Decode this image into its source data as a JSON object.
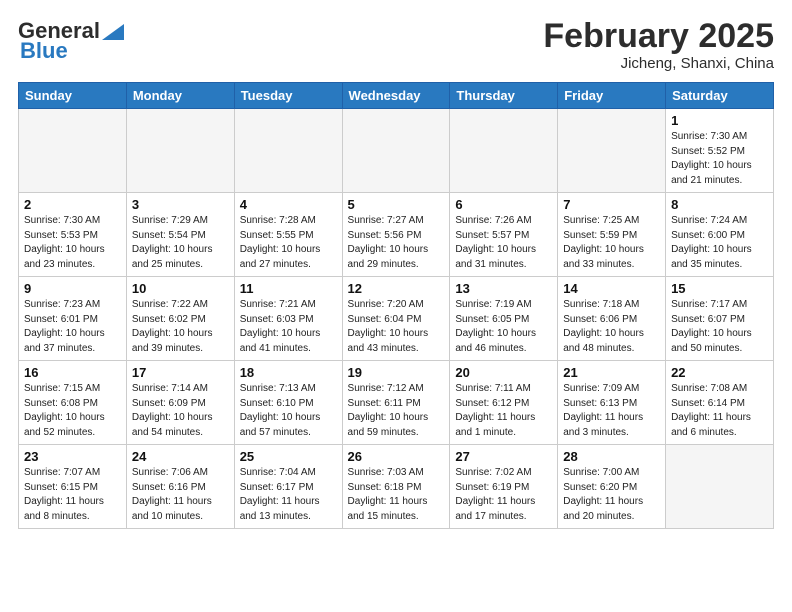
{
  "header": {
    "logo_general": "General",
    "logo_blue": "Blue",
    "month_title": "February 2025",
    "location": "Jicheng, Shanxi, China"
  },
  "weekdays": [
    "Sunday",
    "Monday",
    "Tuesday",
    "Wednesday",
    "Thursday",
    "Friday",
    "Saturday"
  ],
  "weeks": [
    [
      {
        "day": "",
        "info": ""
      },
      {
        "day": "",
        "info": ""
      },
      {
        "day": "",
        "info": ""
      },
      {
        "day": "",
        "info": ""
      },
      {
        "day": "",
        "info": ""
      },
      {
        "day": "",
        "info": ""
      },
      {
        "day": "1",
        "info": "Sunrise: 7:30 AM\nSunset: 5:52 PM\nDaylight: 10 hours and 21 minutes."
      }
    ],
    [
      {
        "day": "2",
        "info": "Sunrise: 7:30 AM\nSunset: 5:53 PM\nDaylight: 10 hours and 23 minutes."
      },
      {
        "day": "3",
        "info": "Sunrise: 7:29 AM\nSunset: 5:54 PM\nDaylight: 10 hours and 25 minutes."
      },
      {
        "day": "4",
        "info": "Sunrise: 7:28 AM\nSunset: 5:55 PM\nDaylight: 10 hours and 27 minutes."
      },
      {
        "day": "5",
        "info": "Sunrise: 7:27 AM\nSunset: 5:56 PM\nDaylight: 10 hours and 29 minutes."
      },
      {
        "day": "6",
        "info": "Sunrise: 7:26 AM\nSunset: 5:57 PM\nDaylight: 10 hours and 31 minutes."
      },
      {
        "day": "7",
        "info": "Sunrise: 7:25 AM\nSunset: 5:59 PM\nDaylight: 10 hours and 33 minutes."
      },
      {
        "day": "8",
        "info": "Sunrise: 7:24 AM\nSunset: 6:00 PM\nDaylight: 10 hours and 35 minutes."
      }
    ],
    [
      {
        "day": "9",
        "info": "Sunrise: 7:23 AM\nSunset: 6:01 PM\nDaylight: 10 hours and 37 minutes."
      },
      {
        "day": "10",
        "info": "Sunrise: 7:22 AM\nSunset: 6:02 PM\nDaylight: 10 hours and 39 minutes."
      },
      {
        "day": "11",
        "info": "Sunrise: 7:21 AM\nSunset: 6:03 PM\nDaylight: 10 hours and 41 minutes."
      },
      {
        "day": "12",
        "info": "Sunrise: 7:20 AM\nSunset: 6:04 PM\nDaylight: 10 hours and 43 minutes."
      },
      {
        "day": "13",
        "info": "Sunrise: 7:19 AM\nSunset: 6:05 PM\nDaylight: 10 hours and 46 minutes."
      },
      {
        "day": "14",
        "info": "Sunrise: 7:18 AM\nSunset: 6:06 PM\nDaylight: 10 hours and 48 minutes."
      },
      {
        "day": "15",
        "info": "Sunrise: 7:17 AM\nSunset: 6:07 PM\nDaylight: 10 hours and 50 minutes."
      }
    ],
    [
      {
        "day": "16",
        "info": "Sunrise: 7:15 AM\nSunset: 6:08 PM\nDaylight: 10 hours and 52 minutes."
      },
      {
        "day": "17",
        "info": "Sunrise: 7:14 AM\nSunset: 6:09 PM\nDaylight: 10 hours and 54 minutes."
      },
      {
        "day": "18",
        "info": "Sunrise: 7:13 AM\nSunset: 6:10 PM\nDaylight: 10 hours and 57 minutes."
      },
      {
        "day": "19",
        "info": "Sunrise: 7:12 AM\nSunset: 6:11 PM\nDaylight: 10 hours and 59 minutes."
      },
      {
        "day": "20",
        "info": "Sunrise: 7:11 AM\nSunset: 6:12 PM\nDaylight: 11 hours and 1 minute."
      },
      {
        "day": "21",
        "info": "Sunrise: 7:09 AM\nSunset: 6:13 PM\nDaylight: 11 hours and 3 minutes."
      },
      {
        "day": "22",
        "info": "Sunrise: 7:08 AM\nSunset: 6:14 PM\nDaylight: 11 hours and 6 minutes."
      }
    ],
    [
      {
        "day": "23",
        "info": "Sunrise: 7:07 AM\nSunset: 6:15 PM\nDaylight: 11 hours and 8 minutes."
      },
      {
        "day": "24",
        "info": "Sunrise: 7:06 AM\nSunset: 6:16 PM\nDaylight: 11 hours and 10 minutes."
      },
      {
        "day": "25",
        "info": "Sunrise: 7:04 AM\nSunset: 6:17 PM\nDaylight: 11 hours and 13 minutes."
      },
      {
        "day": "26",
        "info": "Sunrise: 7:03 AM\nSunset: 6:18 PM\nDaylight: 11 hours and 15 minutes."
      },
      {
        "day": "27",
        "info": "Sunrise: 7:02 AM\nSunset: 6:19 PM\nDaylight: 11 hours and 17 minutes."
      },
      {
        "day": "28",
        "info": "Sunrise: 7:00 AM\nSunset: 6:20 PM\nDaylight: 11 hours and 20 minutes."
      },
      {
        "day": "",
        "info": ""
      }
    ]
  ]
}
